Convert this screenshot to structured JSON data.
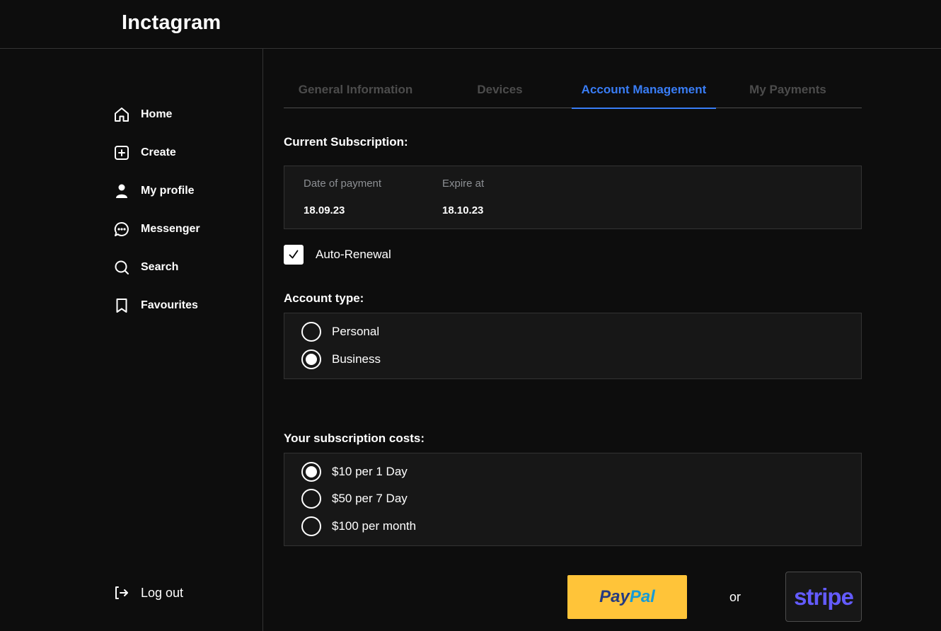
{
  "app": {
    "title": "Inctagram"
  },
  "sidebar": {
    "items": [
      {
        "label": "Home",
        "icon": "home-icon"
      },
      {
        "label": "Create",
        "icon": "plus-square-icon"
      },
      {
        "label": "My profile",
        "icon": "person-icon"
      },
      {
        "label": "Messenger",
        "icon": "message-circle-icon"
      },
      {
        "label": "Search",
        "icon": "search-icon"
      },
      {
        "label": "Favourites",
        "icon": "bookmark-icon"
      }
    ],
    "logout": {
      "label": "Log out",
      "icon": "log-out-icon"
    }
  },
  "tabs": [
    {
      "label": "General Information",
      "active": false
    },
    {
      "label": "Devices",
      "active": false
    },
    {
      "label": "Account Management",
      "active": true
    },
    {
      "label": "My Payments",
      "active": false
    }
  ],
  "subscription": {
    "title": "Current Subscription:",
    "date_label": "Date of payment",
    "date_value": "18.09.23",
    "expire_label": "Expire at",
    "expire_value": "18.10.23"
  },
  "auto_renewal": {
    "label": "Auto-Renewal",
    "checked": true
  },
  "account_type": {
    "title": "Account type:",
    "options": [
      {
        "label": "Personal",
        "selected": false
      },
      {
        "label": "Business",
        "selected": true
      }
    ]
  },
  "costs": {
    "title": "Your subscription costs:",
    "options": [
      {
        "label": "$10 per 1 Day",
        "selected": true
      },
      {
        "label": "$50 per 7 Day",
        "selected": false
      },
      {
        "label": "$100 per month",
        "selected": false
      }
    ]
  },
  "payment": {
    "paypal_label_pay": "Pay",
    "paypal_label_pal": "Pal",
    "or_label": "or",
    "stripe_label": "stripe"
  },
  "colors": {
    "background": "#0d0d0d",
    "panel": "#171717",
    "border": "#333333",
    "accent": "#397df6",
    "muted_text": "#8d9094",
    "inactive_tab": "#4c4c4c",
    "paypal_yellow": "#ffc439",
    "paypal_dark_blue": "#253b80",
    "paypal_light_blue": "#179bd7",
    "stripe_purple": "#635bff"
  }
}
